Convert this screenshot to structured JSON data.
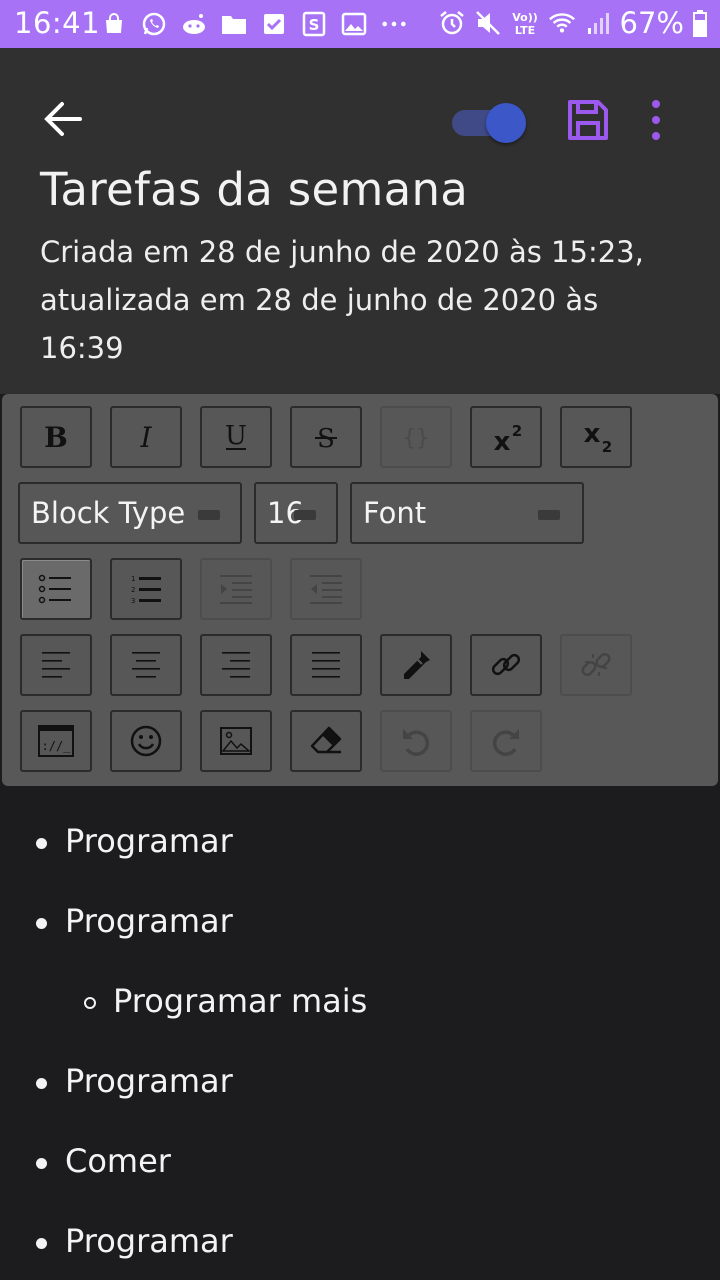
{
  "status_bar": {
    "time": "16:41",
    "battery": "67%",
    "left_icons": [
      "bag-icon",
      "whatsapp-icon",
      "reddit-icon",
      "folder-icon",
      "checkbox-icon",
      "s-note-icon",
      "image-icon",
      "more-dots-icon"
    ],
    "right_icons": [
      "alarm-icon",
      "mute-icon",
      "volte-icon",
      "wifi-icon",
      "signal-icon",
      "battery-icon"
    ],
    "volte_label": "Vo)) LTE"
  },
  "header": {
    "title": "Tarefas da semana",
    "subtitle": "Criada em 28 de junho de 2020 às 15:23, atualizada em 28 de junho de 2020 às 16:39",
    "toggle_on": true
  },
  "toolbar": {
    "block_type": "Block Type",
    "font_size": "16",
    "font": "Font"
  },
  "content": {
    "items": [
      {
        "text": "Programar",
        "level": 0
      },
      {
        "text": "Programar",
        "level": 0
      },
      {
        "text": "Programar mais",
        "level": 1
      },
      {
        "text": "Programar",
        "level": 0
      },
      {
        "text": "Comer",
        "level": 0
      },
      {
        "text": "Programar",
        "level": 0
      }
    ]
  },
  "colors": {
    "status_bar": "#a772f5",
    "header_bg": "#303030",
    "toolbar_bg": "#585858",
    "content_bg": "#1c1b1e",
    "accent": "#9b59f0",
    "toggle": "#3b57c8"
  }
}
